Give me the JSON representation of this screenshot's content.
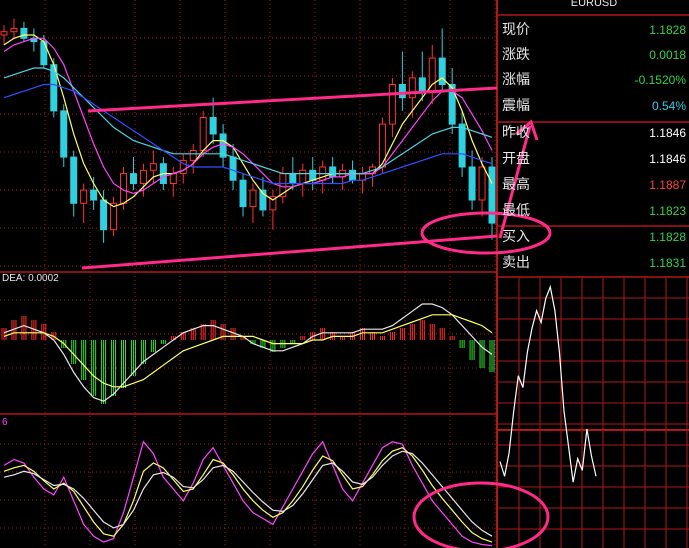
{
  "symbol": "EURUSD",
  "dea_label": "DEA: 0.0002",
  "kdj_label": "6",
  "quote_panel": [
    {
      "label": "现价",
      "value": "1.1828",
      "color": "#34d34a"
    },
    {
      "label": "涨跌",
      "value": "0.0018",
      "color": "#34d34a"
    },
    {
      "label": "涨幅",
      "value": "-0.1520%",
      "color": "#34d34a"
    },
    {
      "label": "震幅",
      "value": "0.54%",
      "color": "#36c8e8"
    },
    {
      "label": "昨收",
      "value": "1.1846",
      "color": "#ffffff"
    },
    {
      "label": "开盘",
      "value": "1.1846",
      "color": "#ffffff"
    },
    {
      "label": "最高",
      "value": "1.1887",
      "color": "#ff4040"
    },
    {
      "label": "最低",
      "value": "1.1823",
      "color": "#34d34a"
    },
    {
      "label": "买入",
      "value": "1.1828",
      "color": "#34d34a"
    },
    {
      "label": "卖出",
      "value": "1.1831",
      "color": "#34d34a"
    }
  ],
  "chart_data": [
    {
      "type": "candlestick",
      "title": "",
      "grid": true,
      "ylim": [
        1.1815,
        1.1895
      ],
      "bull_color": "#ff3030",
      "bear_color": "#30d0e0",
      "candles": [
        [
          1.1885,
          1.1888,
          1.1882,
          1.1886
        ],
        [
          1.1886,
          1.189,
          1.1884,
          1.1887
        ],
        [
          1.1887,
          1.1889,
          1.1883,
          1.1884
        ],
        [
          1.1884,
          1.1887,
          1.188,
          1.1883
        ],
        [
          1.1883,
          1.1885,
          1.1875,
          1.1876
        ],
        [
          1.1876,
          1.1878,
          1.186,
          1.1862
        ],
        [
          1.1862,
          1.1864,
          1.1845,
          1.1848
        ],
        [
          1.1848,
          1.185,
          1.183,
          1.1834
        ],
        [
          1.1834,
          1.184,
          1.1828,
          1.1838
        ],
        [
          1.1838,
          1.1842,
          1.1832,
          1.1835
        ],
        [
          1.1835,
          1.1838,
          1.1822,
          1.1826
        ],
        [
          1.1826,
          1.1836,
          1.1824,
          1.1834
        ],
        [
          1.1834,
          1.1845,
          1.1832,
          1.1843
        ],
        [
          1.1843,
          1.1848,
          1.1838,
          1.184
        ],
        [
          1.184,
          1.1846,
          1.1836,
          1.1844
        ],
        [
          1.1844,
          1.185,
          1.184,
          1.1846
        ],
        [
          1.1846,
          1.1848,
          1.1838,
          1.184
        ],
        [
          1.184,
          1.1845,
          1.1836,
          1.1843
        ],
        [
          1.1843,
          1.1849,
          1.184,
          1.1847
        ],
        [
          1.1847,
          1.1852,
          1.1843,
          1.185
        ],
        [
          1.185,
          1.1862,
          1.1848,
          1.186
        ],
        [
          1.186,
          1.1866,
          1.1852,
          1.1855
        ],
        [
          1.1855,
          1.1858,
          1.1845,
          1.1848
        ],
        [
          1.1848,
          1.1852,
          1.1838,
          1.1841
        ],
        [
          1.1841,
          1.1843,
          1.183,
          1.1833
        ],
        [
          1.1833,
          1.184,
          1.1828,
          1.1838
        ],
        [
          1.1838,
          1.1842,
          1.183,
          1.1832
        ],
        [
          1.1832,
          1.1838,
          1.1826,
          1.1836
        ],
        [
          1.1836,
          1.1845,
          1.1834,
          1.1843
        ],
        [
          1.1843,
          1.1848,
          1.1838,
          1.184
        ],
        [
          1.184,
          1.1846,
          1.1836,
          1.1844
        ],
        [
          1.1844,
          1.1848,
          1.1838,
          1.1841
        ],
        [
          1.1841,
          1.1847,
          1.1837,
          1.1845
        ],
        [
          1.1845,
          1.1848,
          1.184,
          1.1842
        ],
        [
          1.1842,
          1.1846,
          1.1838,
          1.1844
        ],
        [
          1.1844,
          1.1847,
          1.184,
          1.1841
        ],
        [
          1.1841,
          1.1845,
          1.1837,
          1.1843
        ],
        [
          1.1843,
          1.1846,
          1.1839,
          1.1845
        ],
        [
          1.1845,
          1.186,
          1.1843,
          1.1858
        ],
        [
          1.1858,
          1.1872,
          1.1854,
          1.187
        ],
        [
          1.187,
          1.188,
          1.1862,
          1.1866
        ],
        [
          1.1866,
          1.1874,
          1.186,
          1.1872
        ],
        [
          1.1872,
          1.188,
          1.1865,
          1.1868
        ],
        [
          1.1868,
          1.1882,
          1.1864,
          1.1878
        ],
        [
          1.1878,
          1.1887,
          1.1868,
          1.187
        ],
        [
          1.187,
          1.1875,
          1.1855,
          1.1858
        ],
        [
          1.1858,
          1.1862,
          1.1842,
          1.1845
        ],
        [
          1.1845,
          1.185,
          1.1832,
          1.1835
        ],
        [
          1.1835,
          1.1848,
          1.183,
          1.1845
        ],
        [
          1.1845,
          1.1848,
          1.1823,
          1.1828
        ]
      ],
      "ma_lines": [
        {
          "color": "#ffff66",
          "values": [
            1.1882,
            1.1884,
            1.1885,
            1.1885,
            1.1883,
            1.1876,
            1.1866,
            1.1855,
            1.1846,
            1.184,
            1.1835,
            1.1833,
            1.1834,
            1.1836,
            1.1839,
            1.1842,
            1.1843,
            1.1843,
            1.1844,
            1.1846,
            1.185,
            1.1853,
            1.1853,
            1.1851,
            1.1846,
            1.1841,
            1.1837,
            1.1835,
            1.1837,
            1.1839,
            1.184,
            1.1841,
            1.1842,
            1.1843,
            1.1843,
            1.1843,
            1.1843,
            1.1843,
            1.1846,
            1.1852,
            1.1858,
            1.1862,
            1.1866,
            1.187,
            1.1872,
            1.1869,
            1.1862,
            1.1853,
            1.1846,
            1.184
          ]
        },
        {
          "color": "#ff44ff",
          "values": [
            1.188,
            1.1882,
            1.1883,
            1.1884,
            1.1884,
            1.1881,
            1.1876,
            1.1868,
            1.186,
            1.1852,
            1.1845,
            1.184,
            1.1838,
            1.1837,
            1.1838,
            1.184,
            1.1842,
            1.1843,
            1.1844,
            1.1846,
            1.1849,
            1.1851,
            1.1852,
            1.1851,
            1.1849,
            1.1846,
            1.1843,
            1.184,
            1.1839,
            1.1839,
            1.184,
            1.184,
            1.1841,
            1.1842,
            1.1842,
            1.1843,
            1.1843,
            1.1843,
            1.1845,
            1.1849,
            1.1853,
            1.1857,
            1.1861,
            1.1865,
            1.1868,
            1.1868,
            1.1866,
            1.1861,
            1.1856,
            1.185
          ]
        },
        {
          "color": "#4fd2e0",
          "values": [
            1.1872,
            1.1873,
            1.1874,
            1.1875,
            1.1875,
            1.1874,
            1.1872,
            1.1869,
            1.1866,
            1.1863,
            1.186,
            1.1857,
            1.1855,
            1.1853,
            1.1852,
            1.1851,
            1.185,
            1.1849,
            1.1849,
            1.1849,
            1.1849,
            1.1849,
            1.1849,
            1.1848,
            1.1847,
            1.1846,
            1.1845,
            1.1844,
            1.1843,
            1.1843,
            1.1843,
            1.1843,
            1.1843,
            1.1843,
            1.1843,
            1.1843,
            1.1843,
            1.1844,
            1.1845,
            1.1847,
            1.1849,
            1.1851,
            1.1853,
            1.1855,
            1.1856,
            1.1857,
            1.1857,
            1.1856,
            1.1855,
            1.1854
          ]
        },
        {
          "color": "#3050ff",
          "values": [
            1.1866,
            1.1867,
            1.1868,
            1.1869,
            1.187,
            1.187,
            1.1869,
            1.1868,
            1.1866,
            1.1864,
            1.1862,
            1.186,
            1.1858,
            1.1856,
            1.1854,
            1.1852,
            1.185,
            1.1848,
            1.1846,
            1.1845,
            1.1845,
            1.1845,
            1.1845,
            1.1844,
            1.1843,
            1.1842,
            1.1841,
            1.184,
            1.184,
            1.184,
            1.184,
            1.184,
            1.184,
            1.184,
            1.184,
            1.1841,
            1.1841,
            1.1842,
            1.1843,
            1.1844,
            1.1845,
            1.1846,
            1.1847,
            1.1848,
            1.1849,
            1.1849,
            1.1849,
            1.1848,
            1.1847,
            1.1846
          ]
        }
      ]
    },
    {
      "type": "macd",
      "label": "DEA: 0.0002",
      "histogram": [
        3,
        5,
        6,
        5,
        4,
        2,
        -2,
        -6,
        -10,
        -14,
        -16,
        -14,
        -12,
        -9,
        -6,
        -3,
        -1,
        1,
        2,
        3,
        4,
        5,
        4,
        3,
        1,
        -1,
        -2,
        -3,
        -2,
        -1,
        1,
        2,
        3,
        2,
        1,
        2,
        3,
        2,
        1,
        2,
        3,
        4,
        5,
        4,
        3,
        1,
        -2,
        -5,
        -7,
        -8
      ],
      "dif": [
        2,
        3,
        4,
        3,
        2,
        0,
        -4,
        -9,
        -13,
        -16,
        -17,
        -15,
        -12,
        -9,
        -6,
        -4,
        -2,
        0,
        2,
        3,
        4,
        4,
        3,
        2,
        1,
        -1,
        -2,
        -3,
        -3,
        -2,
        -1,
        1,
        2,
        2,
        2,
        2,
        3,
        3,
        3,
        4,
        6,
        8,
        10,
        10,
        9,
        7,
        4,
        1,
        -2,
        -4
      ],
      "dea": [
        1,
        2,
        2,
        2,
        2,
        1,
        -1,
        -4,
        -7,
        -10,
        -12,
        -13,
        -13,
        -12,
        -11,
        -9,
        -7,
        -5,
        -3,
        -2,
        -1,
        0,
        1,
        1,
        1,
        1,
        0,
        -1,
        -1,
        -1,
        -1,
        0,
        0,
        1,
        1,
        1,
        2,
        2,
        2,
        3,
        4,
        5,
        6,
        7,
        7,
        7,
        6,
        5,
        4,
        2
      ]
    },
    {
      "type": "line",
      "label": "6",
      "series": [
        {
          "color": "#ff44ff",
          "values": [
            70,
            75,
            72,
            60,
            50,
            45,
            60,
            40,
            20,
            10,
            5,
            8,
            30,
            60,
            90,
            80,
            60,
            50,
            40,
            55,
            75,
            85,
            70,
            55,
            40,
            30,
            25,
            20,
            35,
            50,
            65,
            80,
            90,
            70,
            50,
            40,
            55,
            70,
            85,
            90,
            88,
            70,
            55,
            40,
            30,
            20,
            10,
            5,
            3,
            2
          ]
        },
        {
          "color": "#ffff66",
          "values": [
            65,
            68,
            70,
            65,
            57,
            50,
            55,
            48,
            35,
            22,
            12,
            10,
            20,
            40,
            65,
            72,
            68,
            58,
            48,
            50,
            62,
            75,
            72,
            62,
            50,
            40,
            32,
            26,
            30,
            40,
            52,
            66,
            78,
            74,
            62,
            50,
            52,
            62,
            74,
            82,
            85,
            78,
            66,
            53,
            42,
            32,
            22,
            13,
            8,
            5
          ]
        },
        {
          "color": "#e8e8e8",
          "values": [
            60,
            62,
            65,
            63,
            58,
            53,
            54,
            50,
            42,
            32,
            22,
            17,
            20,
            32,
            50,
            62,
            64,
            60,
            52,
            51,
            58,
            68,
            70,
            65,
            56,
            47,
            39,
            32,
            31,
            36,
            46,
            58,
            70,
            72,
            65,
            56,
            54,
            60,
            70,
            78,
            82,
            80,
            72,
            62,
            52,
            42,
            32,
            22,
            15,
            10
          ]
        }
      ]
    },
    {
      "type": "line",
      "title": "",
      "values": [
        1.1833,
        1.1828,
        1.1836,
        1.185,
        1.1862,
        1.1858,
        1.187,
        1.1878,
        1.1884,
        1.188,
        1.1888,
        1.1892,
        1.1884,
        1.187,
        1.185,
        1.1838,
        1.1826,
        1.1834,
        1.183,
        1.1844,
        1.1835,
        1.1828
      ]
    }
  ]
}
